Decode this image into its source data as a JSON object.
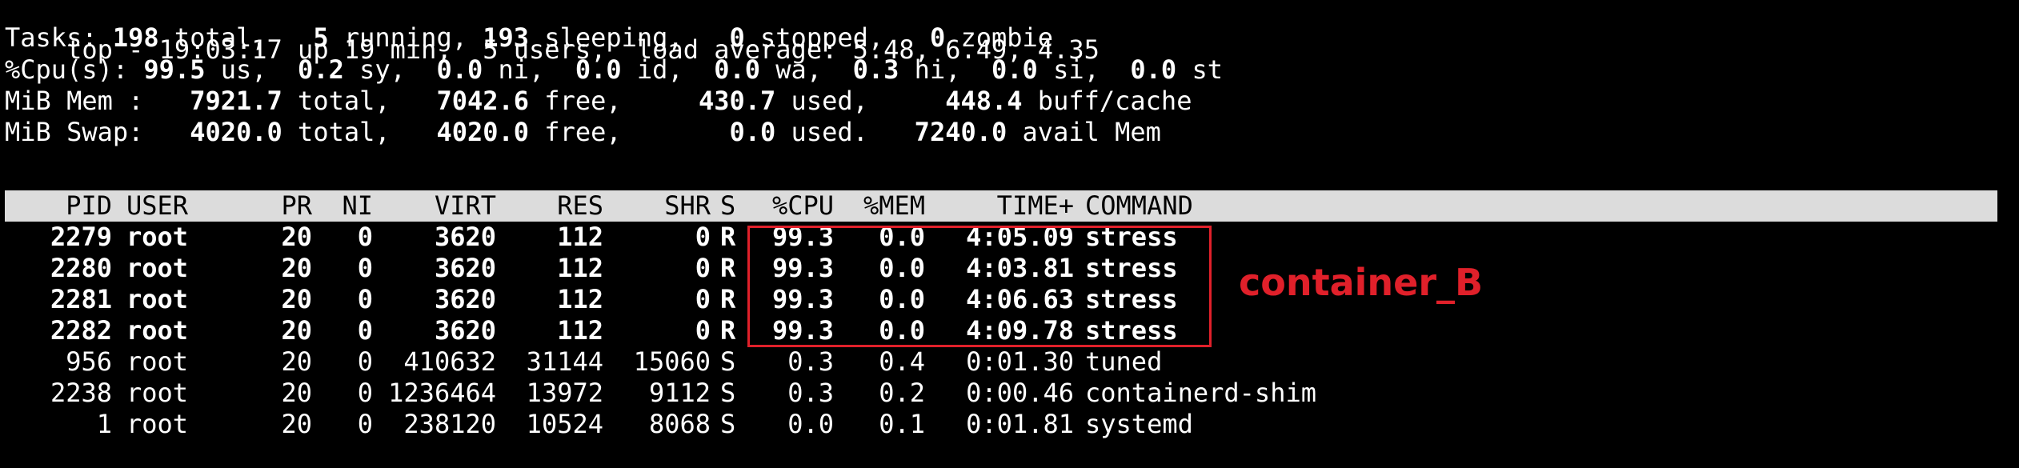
{
  "summary": {
    "line1": {
      "prefix": "top - 19:03:17 up 19 min,  5 users,  load average: 5.48, 6.49, 4.35"
    },
    "tasks": {
      "label": "Tasks:",
      "total": "198",
      "total_label": "total,",
      "running": "5",
      "running_label": "running,",
      "sleeping": "193",
      "sleeping_label": "sleeping,",
      "stopped": "0",
      "stopped_label": "stopped,",
      "zombie": "0",
      "zombie_label": "zombie"
    },
    "cpu": {
      "label": "%Cpu(s):",
      "us": "99.5",
      "us_label": "us,",
      "sy": "0.2",
      "sy_label": "sy,",
      "ni": "0.0",
      "ni_label": "ni,",
      "id": "0.0",
      "id_label": "id,",
      "wa": "0.0",
      "wa_label": "wa,",
      "hi": "0.3",
      "hi_label": "hi,",
      "si": "0.0",
      "si_label": "si,",
      "st": "0.0",
      "st_label": "st"
    },
    "mem": {
      "label": "MiB Mem :",
      "total": "7921.7",
      "total_label": "total,",
      "free": "7042.6",
      "free_label": "free,",
      "used": "430.7",
      "used_label": "used,",
      "cache": "448.4",
      "cache_label": "buff/cache"
    },
    "swap": {
      "label": "MiB Swap:",
      "total": "4020.0",
      "total_label": "total,",
      "free": "4020.0",
      "free_label": "free,",
      "used": "0.0",
      "used_label": "used.",
      "avail": "7240.0",
      "avail_label": "avail Mem"
    }
  },
  "table": {
    "headers": {
      "pid": "PID",
      "user": "USER",
      "pr": "PR",
      "ni": "NI",
      "virt": "VIRT",
      "res": "RES",
      "shr": "SHR",
      "s": "S",
      "cpu": "%CPU",
      "mem": "%MEM",
      "time": "TIME+",
      "command": "COMMAND"
    },
    "rows": [
      {
        "pid": "2279",
        "user": "root",
        "pr": "20",
        "ni": "0",
        "virt": "3620",
        "res": "112",
        "shr": "0",
        "s": "R",
        "cpu": "99.3",
        "mem": "0.0",
        "time": "4:05.09",
        "command": "stress",
        "bold": true
      },
      {
        "pid": "2280",
        "user": "root",
        "pr": "20",
        "ni": "0",
        "virt": "3620",
        "res": "112",
        "shr": "0",
        "s": "R",
        "cpu": "99.3",
        "mem": "0.0",
        "time": "4:03.81",
        "command": "stress",
        "bold": true
      },
      {
        "pid": "2281",
        "user": "root",
        "pr": "20",
        "ni": "0",
        "virt": "3620",
        "res": "112",
        "shr": "0",
        "s": "R",
        "cpu": "99.3",
        "mem": "0.0",
        "time": "4:06.63",
        "command": "stress",
        "bold": true
      },
      {
        "pid": "2282",
        "user": "root",
        "pr": "20",
        "ni": "0",
        "virt": "3620",
        "res": "112",
        "shr": "0",
        "s": "R",
        "cpu": "99.3",
        "mem": "0.0",
        "time": "4:09.78",
        "command": "stress",
        "bold": true
      },
      {
        "pid": "956",
        "user": "root",
        "pr": "20",
        "ni": "0",
        "virt": "410632",
        "res": "31144",
        "shr": "15060",
        "s": "S",
        "cpu": "0.3",
        "mem": "0.4",
        "time": "0:01.30",
        "command": "tuned",
        "bold": false
      },
      {
        "pid": "2238",
        "user": "root",
        "pr": "20",
        "ni": "0",
        "virt": "1236464",
        "res": "13972",
        "shr": "9112",
        "s": "S",
        "cpu": "0.3",
        "mem": "0.2",
        "time": "0:00.46",
        "command": "containerd-shim",
        "bold": false
      },
      {
        "pid": "1",
        "user": "root",
        "pr": "20",
        "ni": "0",
        "virt": "238120",
        "res": "10524",
        "shr": "8068",
        "s": "S",
        "cpu": "0.0",
        "mem": "0.1",
        "time": "0:01.81",
        "command": "systemd",
        "bold": false
      }
    ]
  },
  "annotation": {
    "label": "container_B",
    "color": "#e0202a"
  },
  "colors": {
    "background": "#000000",
    "foreground": "#ffffff",
    "header_bar": "#dcdcdc",
    "header_text": "#000000"
  }
}
